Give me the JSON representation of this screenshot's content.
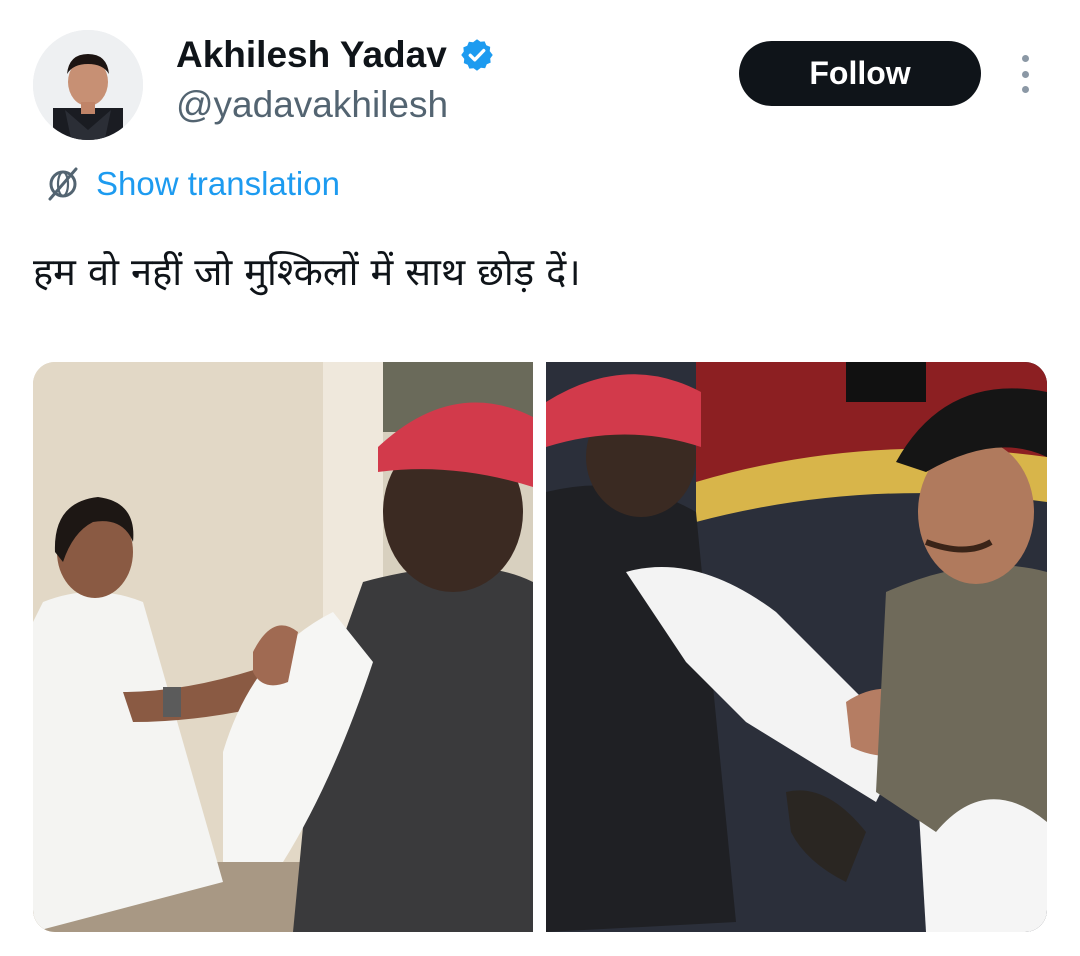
{
  "author": {
    "name": "Akhilesh Yadav",
    "handle": "@yadavakhilesh",
    "avatar_icon": "profile-photo",
    "verified_icon": "verified-badge-icon",
    "verified_color": "#1d9bf0"
  },
  "actions": {
    "follow_label": "Follow",
    "more_icon": "more-options-icon"
  },
  "translation": {
    "label": "Show translation",
    "icon": "translate-globe-icon",
    "color": "#1d9bf0"
  },
  "tweet": {
    "text": "हम वो नहीं जो मुश्किलों में साथ छोड़ दें।"
  },
  "media": [
    {
      "type": "photo",
      "description_icon": "photo-1"
    },
    {
      "type": "photo",
      "description_icon": "photo-2"
    }
  ],
  "colors": {
    "text_primary": "#0f1419",
    "text_secondary": "#536471",
    "button_bg": "#0f1419",
    "button_text": "#ffffff"
  }
}
